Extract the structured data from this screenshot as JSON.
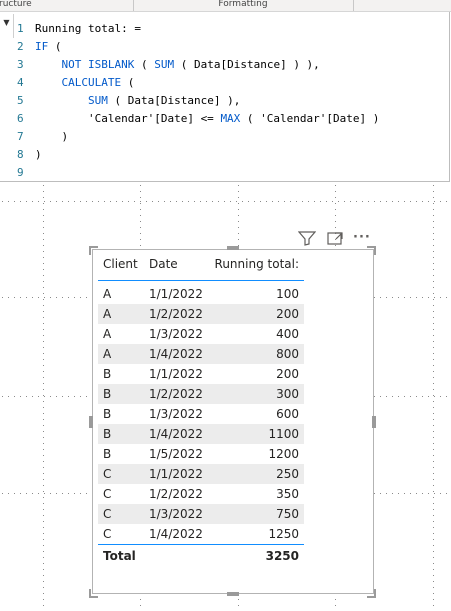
{
  "ribbon": {
    "left_label": "ructure",
    "center_label": "Formatting"
  },
  "editor": {
    "expand_glyph": "▼",
    "lines": [
      {
        "n": "1",
        "parts": [
          [
            "op",
            "Running total: ="
          ]
        ]
      },
      {
        "n": "2",
        "parts": [
          [
            "kw",
            "IF"
          ],
          [
            "op",
            " ("
          ]
        ]
      },
      {
        "n": "3",
        "parts": [
          [
            "op",
            "    "
          ],
          [
            "kw",
            "NOT ISBLANK"
          ],
          [
            "op",
            " ( "
          ],
          [
            "kw",
            "SUM"
          ],
          [
            "op",
            " ( Data[Distance] ) ),"
          ]
        ]
      },
      {
        "n": "4",
        "parts": [
          [
            "op",
            "    "
          ],
          [
            "kw",
            "CALCULATE"
          ],
          [
            "op",
            " ("
          ]
        ]
      },
      {
        "n": "5",
        "parts": [
          [
            "op",
            "        "
          ],
          [
            "kw",
            "SUM"
          ],
          [
            "op",
            " ( Data[Distance] ),"
          ]
        ]
      },
      {
        "n": "6",
        "parts": [
          [
            "op",
            "        'Calendar'[Date] <= "
          ],
          [
            "kw",
            "MAX"
          ],
          [
            "op",
            " ( 'Calendar'[Date] )"
          ]
        ]
      },
      {
        "n": "7",
        "parts": [
          [
            "op",
            "    )"
          ]
        ]
      },
      {
        "n": "8",
        "parts": [
          [
            "op",
            ")"
          ]
        ]
      },
      {
        "n": "9",
        "parts": []
      }
    ]
  },
  "visual_header": {
    "filter_icon": "filter-icon",
    "focus_icon": "focus-mode-icon",
    "more_icon": "more-options-icon",
    "more_glyph": "···"
  },
  "table": {
    "columns": [
      "Client",
      "Date",
      "Running total:"
    ],
    "rows": [
      [
        "A",
        "1/1/2022",
        "100"
      ],
      [
        "A",
        "1/2/2022",
        "200"
      ],
      [
        "A",
        "1/3/2022",
        "400"
      ],
      [
        "A",
        "1/4/2022",
        "800"
      ],
      [
        "B",
        "1/1/2022",
        "200"
      ],
      [
        "B",
        "1/2/2022",
        "300"
      ],
      [
        "B",
        "1/3/2022",
        "600"
      ],
      [
        "B",
        "1/4/2022",
        "1100"
      ],
      [
        "B",
        "1/5/2022",
        "1200"
      ],
      [
        "C",
        "1/1/2022",
        "250"
      ],
      [
        "C",
        "1/2/2022",
        "350"
      ],
      [
        "C",
        "1/3/2022",
        "750"
      ],
      [
        "C",
        "1/4/2022",
        "1250"
      ]
    ],
    "total_label": "Total",
    "total_value": "3250",
    "header_rule_color": "#118dff",
    "alt_row_color": "#ececec"
  }
}
